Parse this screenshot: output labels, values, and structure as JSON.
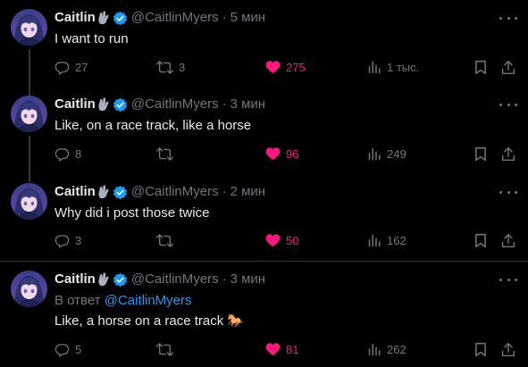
{
  "colors": {
    "background": "#000000",
    "text": "#e7e9ea",
    "muted": "#71767b",
    "like": "#f91880",
    "link": "#1d9bf0",
    "verified": "#1d9bf0"
  },
  "tweets": [
    {
      "name": "Caitlin",
      "handle": "@CaitlinMyers",
      "dot": "·",
      "time": "5 мин",
      "text": "I want to run",
      "replies": "27",
      "retweets": "3",
      "likes": "275",
      "views": "1 тыс."
    },
    {
      "name": "Caitlin",
      "handle": "@CaitlinMyers",
      "dot": "·",
      "time": "3 мин",
      "text": "Like, on a race track, like a horse",
      "replies": "8",
      "retweets": "",
      "likes": "96",
      "views": "249"
    },
    {
      "name": "Caitlin",
      "handle": "@CaitlinMyers",
      "dot": "·",
      "time": "2 мин",
      "text": "Why did i post those twice",
      "replies": "3",
      "retweets": "",
      "likes": "50",
      "views": "162"
    },
    {
      "name": "Caitlin",
      "handle": "@CaitlinMyers",
      "dot": "·",
      "time": "3 мин",
      "reply_prefix": "В ответ ",
      "reply_mention": "@CaitlinMyers",
      "text": "Like, a horse on a race track 🐎",
      "replies": "5",
      "retweets": "",
      "likes": "81",
      "views": "262"
    }
  ],
  "icons": {
    "badge": "fingers-crossed-icon",
    "verified": "verified-badge-icon",
    "more": "more-icon",
    "reply": "reply-icon",
    "retweet": "retweet-icon",
    "like": "heart-icon",
    "views": "views-icon",
    "bookmark": "bookmark-icon",
    "share": "share-icon"
  }
}
